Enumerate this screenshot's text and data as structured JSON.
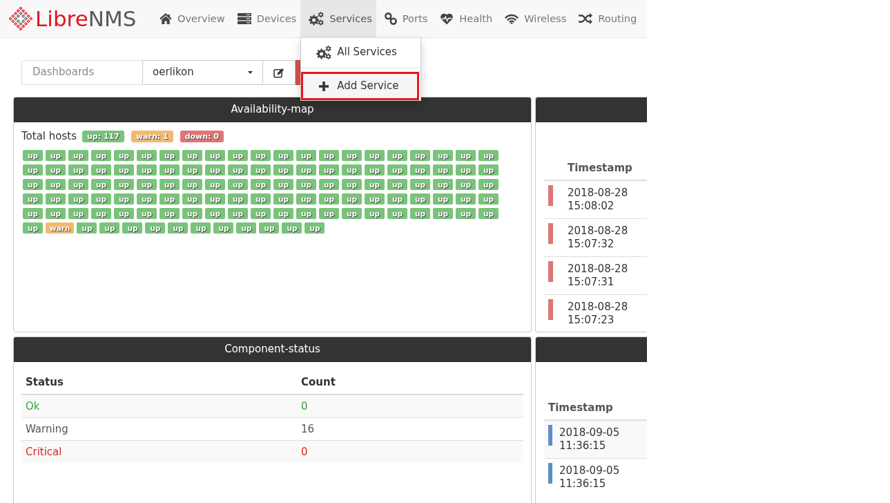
{
  "navbar": {
    "logo": [
      {
        "text": "Libre",
        "color": "#e3151d"
      },
      {
        "text": "NMS",
        "color": "#58585a"
      }
    ],
    "items": [
      {
        "label": "Overview",
        "selected": false
      },
      {
        "label": "Devices",
        "selected": false
      },
      {
        "label": "Services",
        "selected": true,
        "menu": [
          {
            "label": "All Services",
            "highlighted": false
          },
          {
            "label": "Add Service",
            "highlighted": true
          }
        ]
      },
      {
        "label": "Ports",
        "selected": false
      },
      {
        "label": "Health",
        "selected": false
      },
      {
        "label": "Wireless",
        "selected": false
      },
      {
        "label": "Routing",
        "selected": false
      }
    ]
  },
  "toolbar": {
    "label": "Dashboards",
    "dashboard": "oerlikon"
  },
  "panels": [
    {
      "kind": "availability",
      "title": "Availability-map",
      "summary_label": "Total hosts",
      "summary": [
        {
          "label": "up: 117",
          "color": "#79c37a"
        },
        {
          "label": "warn: 1",
          "color": "#f3b96f"
        },
        {
          "label": "down: 0",
          "color": "#e07575"
        }
      ],
      "hosts": [
        {
          "label": "up",
          "color": "#79c37a"
        },
        {
          "label": "up",
          "color": "#79c37a"
        },
        {
          "label": "up",
          "color": "#79c37a"
        },
        {
          "label": "up",
          "color": "#79c37a"
        },
        {
          "label": "up",
          "color": "#79c37a"
        },
        {
          "label": "up",
          "color": "#79c37a"
        },
        {
          "label": "up",
          "color": "#79c37a"
        },
        {
          "label": "up",
          "color": "#79c37a"
        },
        {
          "label": "up",
          "color": "#79c37a"
        },
        {
          "label": "up",
          "color": "#79c37a"
        },
        {
          "label": "up",
          "color": "#79c37a"
        },
        {
          "label": "up",
          "color": "#79c37a"
        },
        {
          "label": "up",
          "color": "#79c37a"
        },
        {
          "label": "up",
          "color": "#79c37a"
        },
        {
          "label": "up",
          "color": "#79c37a"
        },
        {
          "label": "up",
          "color": "#79c37a"
        },
        {
          "label": "up",
          "color": "#79c37a"
        },
        {
          "label": "up",
          "color": "#79c37a"
        },
        {
          "label": "up",
          "color": "#79c37a"
        },
        {
          "label": "up",
          "color": "#79c37a"
        },
        {
          "label": "up",
          "color": "#79c37a"
        },
        {
          "label": "up",
          "color": "#79c37a"
        },
        {
          "label": "up",
          "color": "#79c37a"
        },
        {
          "label": "up",
          "color": "#79c37a"
        },
        {
          "label": "up",
          "color": "#79c37a"
        },
        {
          "label": "up",
          "color": "#79c37a"
        },
        {
          "label": "up",
          "color": "#79c37a"
        },
        {
          "label": "up",
          "color": "#79c37a"
        },
        {
          "label": "up",
          "color": "#79c37a"
        },
        {
          "label": "up",
          "color": "#79c37a"
        },
        {
          "label": "up",
          "color": "#79c37a"
        },
        {
          "label": "up",
          "color": "#79c37a"
        },
        {
          "label": "up",
          "color": "#79c37a"
        },
        {
          "label": "up",
          "color": "#79c37a"
        },
        {
          "label": "up",
          "color": "#79c37a"
        },
        {
          "label": "up",
          "color": "#79c37a"
        },
        {
          "label": "up",
          "color": "#79c37a"
        },
        {
          "label": "up",
          "color": "#79c37a"
        },
        {
          "label": "up",
          "color": "#79c37a"
        },
        {
          "label": "up",
          "color": "#79c37a"
        },
        {
          "label": "up",
          "color": "#79c37a"
        },
        {
          "label": "up",
          "color": "#79c37a"
        },
        {
          "label": "up",
          "color": "#79c37a"
        },
        {
          "label": "up",
          "color": "#79c37a"
        },
        {
          "label": "up",
          "color": "#79c37a"
        },
        {
          "label": "up",
          "color": "#79c37a"
        },
        {
          "label": "up",
          "color": "#79c37a"
        },
        {
          "label": "up",
          "color": "#79c37a"
        },
        {
          "label": "up",
          "color": "#79c37a"
        },
        {
          "label": "up",
          "color": "#79c37a"
        },
        {
          "label": "up",
          "color": "#79c37a"
        },
        {
          "label": "up",
          "color": "#79c37a"
        },
        {
          "label": "up",
          "color": "#79c37a"
        },
        {
          "label": "up",
          "color": "#79c37a"
        },
        {
          "label": "up",
          "color": "#79c37a"
        },
        {
          "label": "up",
          "color": "#79c37a"
        },
        {
          "label": "up",
          "color": "#79c37a"
        },
        {
          "label": "up",
          "color": "#79c37a"
        },
        {
          "label": "up",
          "color": "#79c37a"
        },
        {
          "label": "up",
          "color": "#79c37a"
        },
        {
          "label": "up",
          "color": "#79c37a"
        },
        {
          "label": "up",
          "color": "#79c37a"
        },
        {
          "label": "up",
          "color": "#79c37a"
        },
        {
          "label": "up",
          "color": "#79c37a"
        },
        {
          "label": "up",
          "color": "#79c37a"
        },
        {
          "label": "up",
          "color": "#79c37a"
        },
        {
          "label": "up",
          "color": "#79c37a"
        },
        {
          "label": "up",
          "color": "#79c37a"
        },
        {
          "label": "up",
          "color": "#79c37a"
        },
        {
          "label": "up",
          "color": "#79c37a"
        },
        {
          "label": "up",
          "color": "#79c37a"
        },
        {
          "label": "up",
          "color": "#79c37a"
        },
        {
          "label": "up",
          "color": "#79c37a"
        },
        {
          "label": "up",
          "color": "#79c37a"
        },
        {
          "label": "up",
          "color": "#79c37a"
        },
        {
          "label": "up",
          "color": "#79c37a"
        },
        {
          "label": "up",
          "color": "#79c37a"
        },
        {
          "label": "up",
          "color": "#79c37a"
        },
        {
          "label": "up",
          "color": "#79c37a"
        },
        {
          "label": "up",
          "color": "#79c37a"
        },
        {
          "label": "up",
          "color": "#79c37a"
        },
        {
          "label": "up",
          "color": "#79c37a"
        },
        {
          "label": "up",
          "color": "#79c37a"
        },
        {
          "label": "up",
          "color": "#79c37a"
        },
        {
          "label": "up",
          "color": "#79c37a"
        },
        {
          "label": "up",
          "color": "#79c37a"
        },
        {
          "label": "up",
          "color": "#79c37a"
        },
        {
          "label": "up",
          "color": "#79c37a"
        },
        {
          "label": "up",
          "color": "#79c37a"
        },
        {
          "label": "up",
          "color": "#79c37a"
        },
        {
          "label": "up",
          "color": "#79c37a"
        },
        {
          "label": "up",
          "color": "#79c37a"
        },
        {
          "label": "up",
          "color": "#79c37a"
        },
        {
          "label": "up",
          "color": "#79c37a"
        },
        {
          "label": "up",
          "color": "#79c37a"
        },
        {
          "label": "up",
          "color": "#79c37a"
        },
        {
          "label": "up",
          "color": "#79c37a"
        },
        {
          "label": "up",
          "color": "#79c37a"
        },
        {
          "label": "up",
          "color": "#79c37a"
        },
        {
          "label": "up",
          "color": "#79c37a"
        },
        {
          "label": "up",
          "color": "#79c37a"
        },
        {
          "label": "up",
          "color": "#79c37a"
        },
        {
          "label": "up",
          "color": "#79c37a"
        },
        {
          "label": "up",
          "color": "#79c37a"
        },
        {
          "label": "up",
          "color": "#79c37a"
        },
        {
          "label": "up",
          "color": "#79c37a"
        },
        {
          "label": "warn",
          "color": "#f3b96f"
        },
        {
          "label": "up",
          "color": "#79c37a"
        },
        {
          "label": "up",
          "color": "#79c37a"
        },
        {
          "label": "up",
          "color": "#79c37a"
        },
        {
          "label": "up",
          "color": "#79c37a"
        },
        {
          "label": "up",
          "color": "#79c37a"
        },
        {
          "label": "up",
          "color": "#79c37a"
        },
        {
          "label": "up",
          "color": "#79c37a"
        },
        {
          "label": "up",
          "color": "#79c37a"
        },
        {
          "label": "up",
          "color": "#79c37a"
        },
        {
          "label": "up",
          "color": "#79c37a"
        },
        {
          "label": "up",
          "color": "#79c37a"
        }
      ]
    },
    {
      "kind": "alertlog",
      "header": "Timestamp",
      "rows": [
        {
          "timestamp": "2018-08-28 15:08:02",
          "color": "#e07575"
        },
        {
          "timestamp": "2018-08-28 15:07:32",
          "color": "#e07575"
        },
        {
          "timestamp": "2018-08-28 15:07:31",
          "color": "#e07575"
        },
        {
          "timestamp": "2018-08-28 15:07:23",
          "color": "#e07575"
        }
      ]
    },
    {
      "kind": "status",
      "title": "Component-status",
      "columns": [
        "Status",
        "Count"
      ],
      "rows": [
        {
          "status": "Ok",
          "count": "0",
          "color": "#33a533"
        },
        {
          "status": "Warning",
          "count": "16",
          "color": "#555555"
        },
        {
          "status": "Critical",
          "count": "0",
          "color": "#e02424"
        }
      ]
    },
    {
      "kind": "eventlog",
      "header": "Timestamp",
      "rows": [
        {
          "timestamp": "2018-09-05 11:36:15",
          "color": "#5b8fc8"
        },
        {
          "timestamp": "2018-09-05 11:36:15",
          "color": "#5b8fc8"
        }
      ]
    }
  ]
}
